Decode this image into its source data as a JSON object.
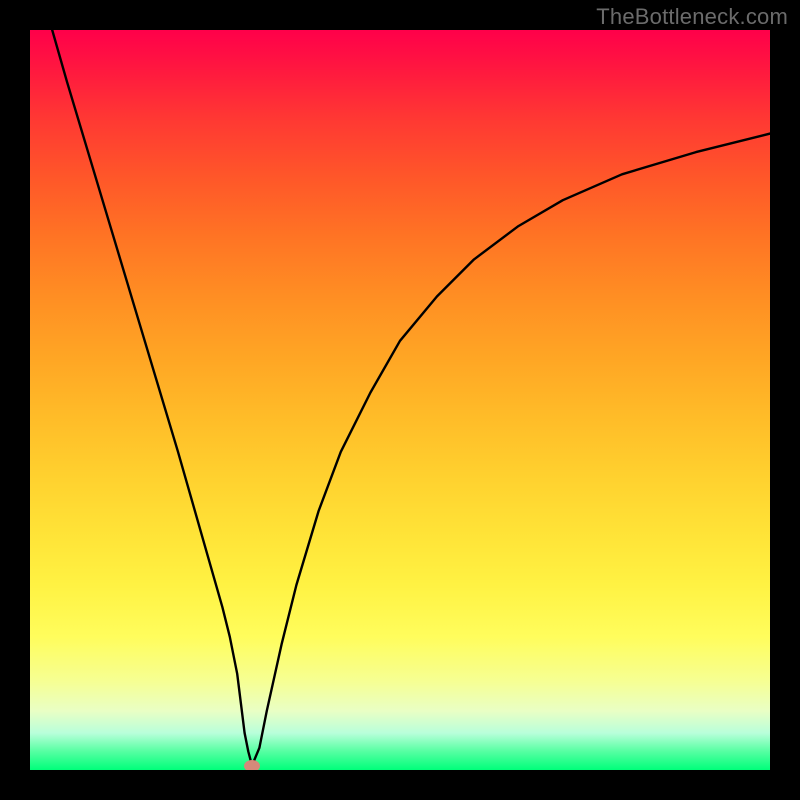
{
  "watermark": "TheBottleneck.com",
  "colors": {
    "frame_bg": "#000000",
    "curve_stroke": "#000000",
    "marker_fill": "#d48a7a"
  },
  "chart_data": {
    "type": "line",
    "title": "",
    "xlabel": "",
    "ylabel": "",
    "xlim": [
      0,
      100
    ],
    "ylim": [
      0,
      100
    ],
    "annotations": [],
    "series": [
      {
        "name": "curve",
        "x": [
          3,
          5,
          8,
          11,
          14,
          17,
          20,
          22,
          24,
          26,
          27,
          28,
          28.5,
          29,
          29.5,
          30,
          31,
          32,
          34,
          36,
          39,
          42,
          46,
          50,
          55,
          60,
          66,
          72,
          80,
          90,
          100
        ],
        "y": [
          100,
          93,
          83,
          73,
          63,
          53,
          43,
          36,
          29,
          22,
          18,
          13,
          9,
          5,
          2.5,
          0.6,
          3,
          8,
          17,
          25,
          35,
          43,
          51,
          58,
          64,
          69,
          73.5,
          77,
          80.5,
          83.5,
          86
        ]
      }
    ],
    "marker": {
      "x": 30,
      "y": 0.6
    },
    "gradient_stops": [
      {
        "pos": 0,
        "color": "#ff004a"
      },
      {
        "pos": 50,
        "color": "#ffc828"
      },
      {
        "pos": 82,
        "color": "#fffd5c"
      },
      {
        "pos": 100,
        "color": "#00ff7a"
      }
    ]
  }
}
